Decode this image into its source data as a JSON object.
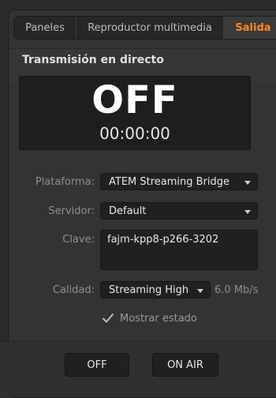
{
  "tabs": [
    {
      "label": "Paneles"
    },
    {
      "label": "Reproductor multimedia"
    },
    {
      "label": "Salida",
      "active": true,
      "color": "#ff8a1f"
    }
  ],
  "section": {
    "title": "Transmisión en directo"
  },
  "status": {
    "state": "OFF",
    "time": "00:00:00"
  },
  "form": {
    "platform": {
      "label": "Plataforma:",
      "value": "ATEM Streaming Bridge"
    },
    "server": {
      "label": "Servidor:",
      "value": "Default"
    },
    "key": {
      "label": "Clave:",
      "value": "fajm-kpp8-p266-3202"
    },
    "quality": {
      "label": "Calidad:",
      "value": "Streaming High",
      "rate": "6.0 Mb/s"
    },
    "show_status": {
      "label": "Mostrar estado",
      "checked": true
    }
  },
  "buttons": {
    "off": "OFF",
    "on_air": "ON AIR"
  },
  "colors": {
    "accent": "#ff8a1f",
    "panel": "#333333",
    "field": "#202020"
  }
}
